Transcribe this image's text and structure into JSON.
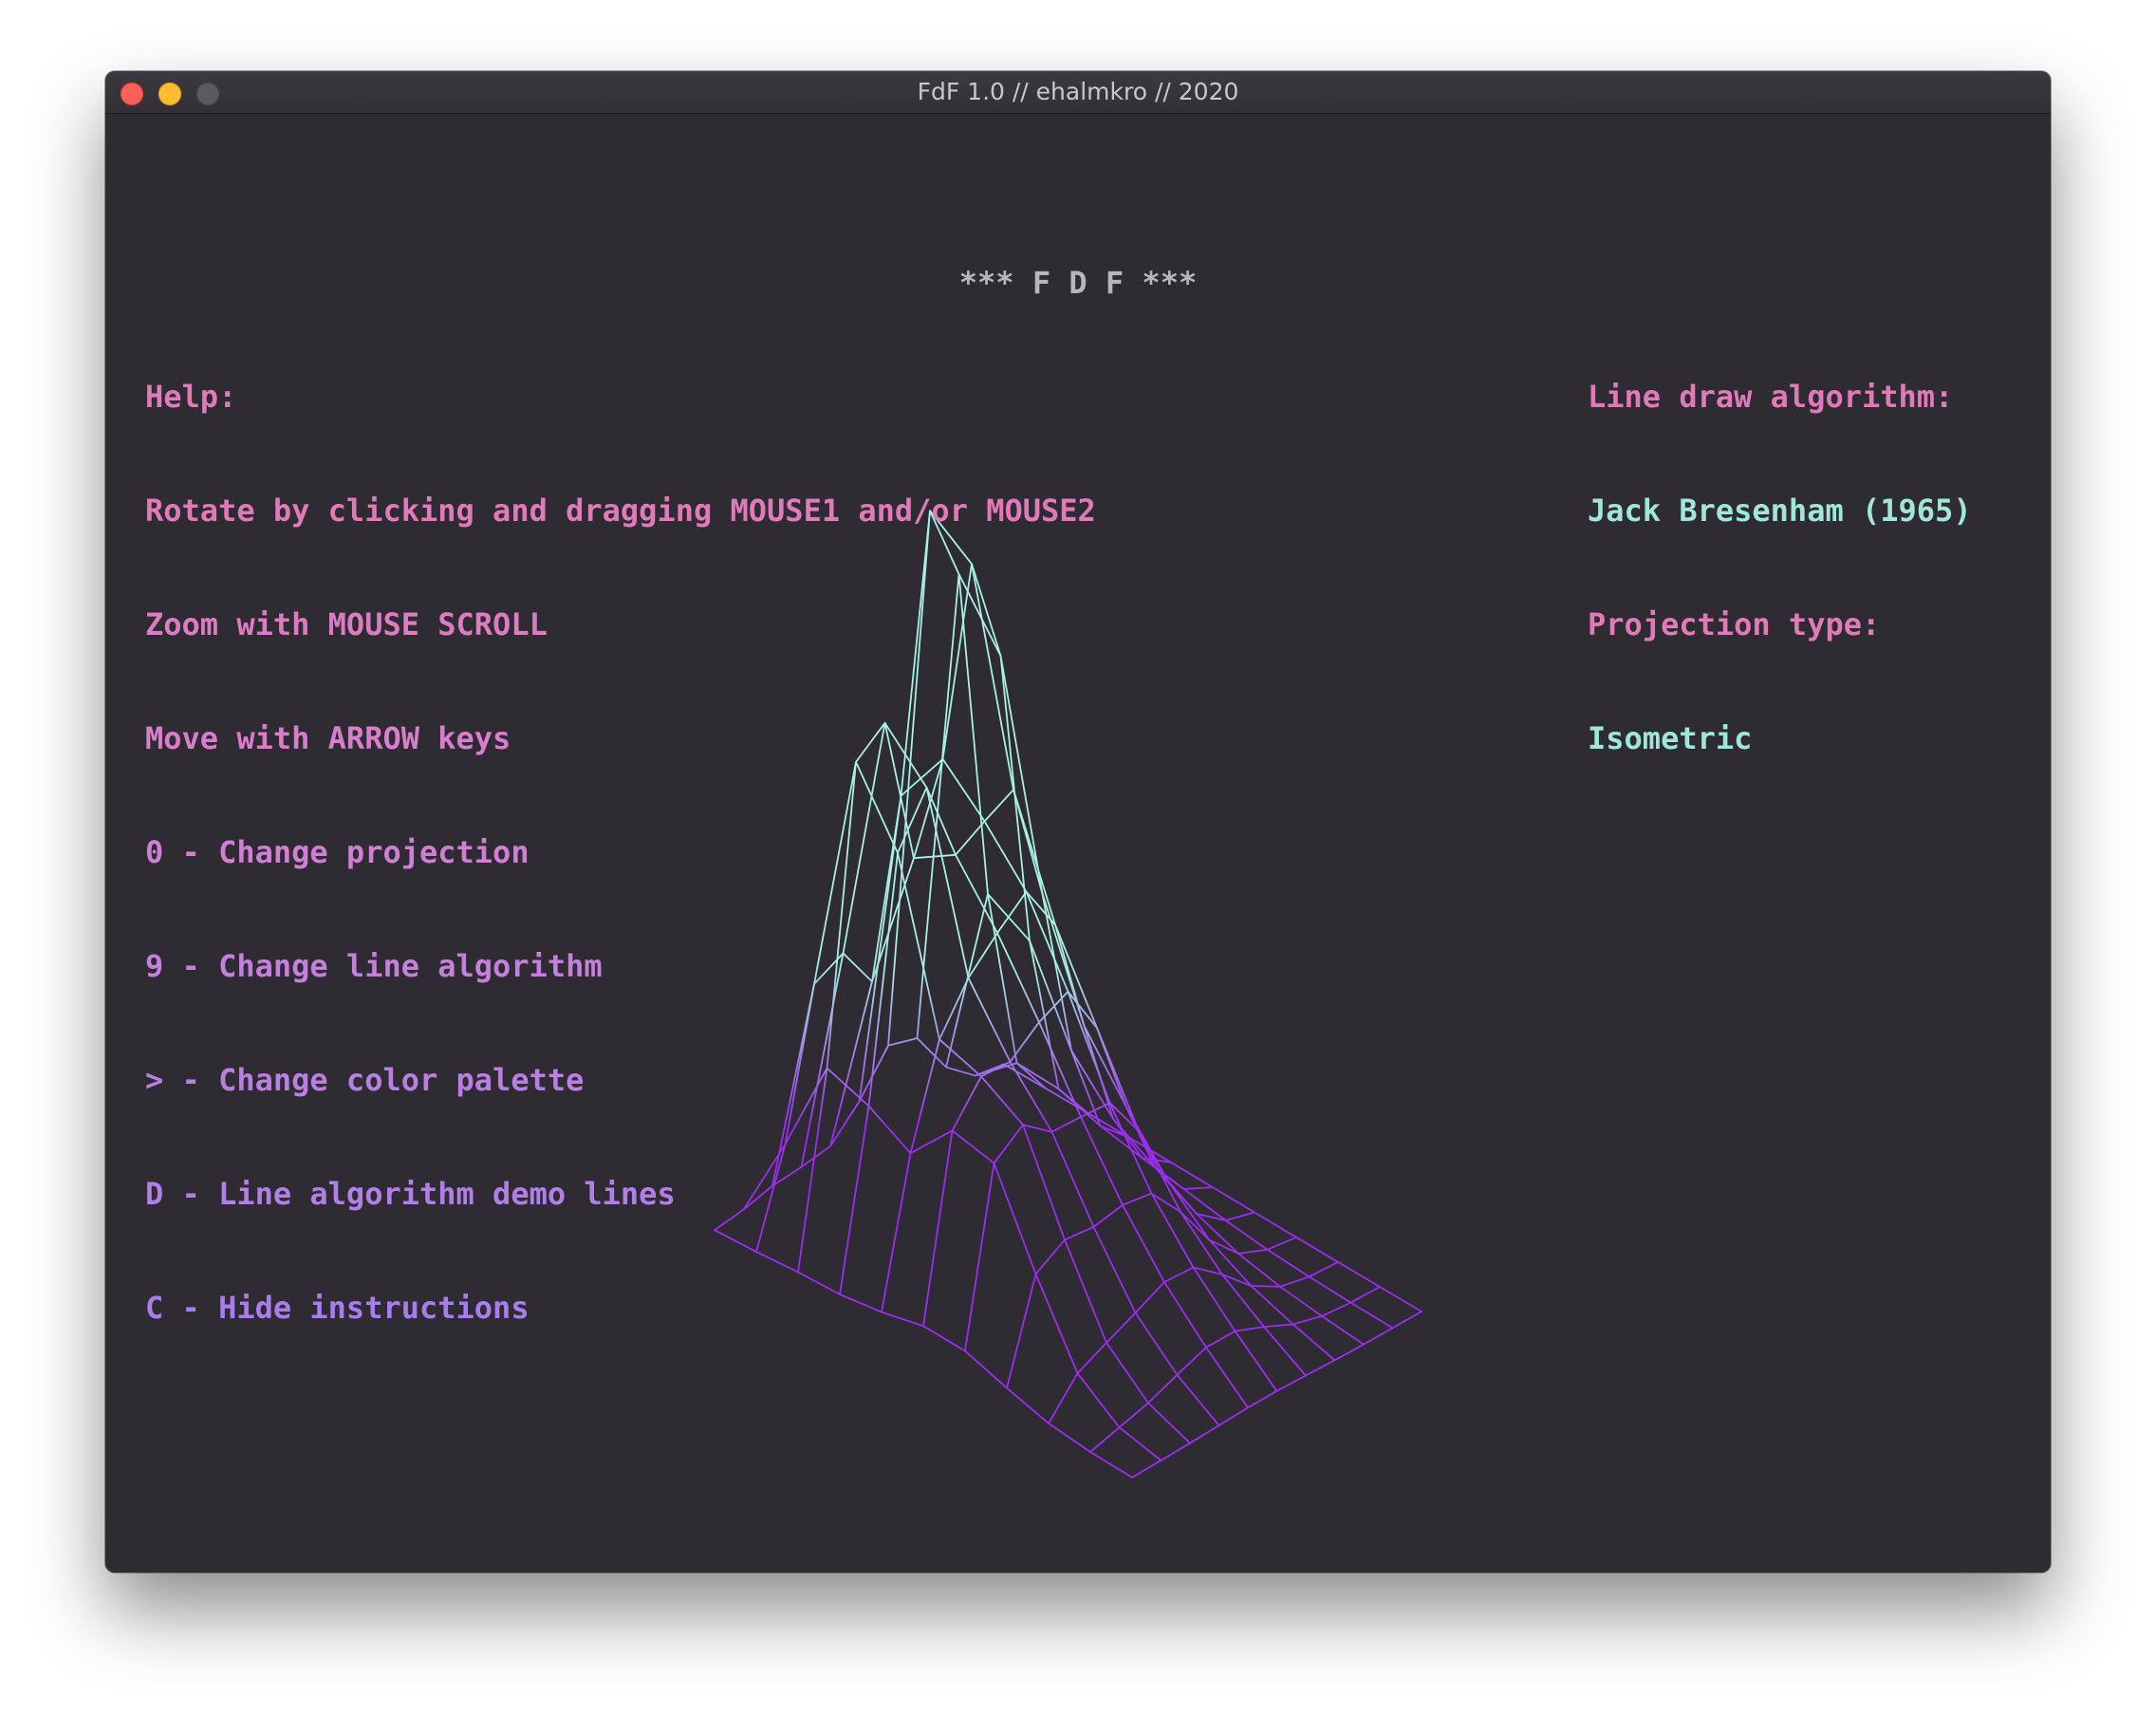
{
  "window": {
    "title": "FdF 1.0 // ehalmkro // 2020"
  },
  "banner": "*** F D F ***",
  "help": {
    "heading": "Help:",
    "lines": [
      "Rotate by clicking and dragging MOUSE1 and/or MOUSE2",
      "Zoom with MOUSE SCROLL",
      "Move with ARROW keys",
      "0 - Change projection",
      "9 - Change line algorithm",
      "> - Change color palette",
      "D - Line algorithm demo lines",
      "C - Hide instructions"
    ]
  },
  "status": {
    "algorithm_label": "Line draw algorithm:",
    "algorithm_value": "Jack Bresenham (1965)",
    "projection_label": "Projection type:",
    "projection_value": "Isometric"
  },
  "colors": {
    "window_bg": "#2f2b33",
    "label_pink": "#e07ab8",
    "value_cyan": "#9fe8d8",
    "wire_low": "#9b2cf0",
    "wire_high": "#a8f0e0",
    "banner": "#b8b6ba",
    "close": "#fe5f57",
    "minimize": "#febc2e",
    "zoom": "#5b5a5d"
  }
}
